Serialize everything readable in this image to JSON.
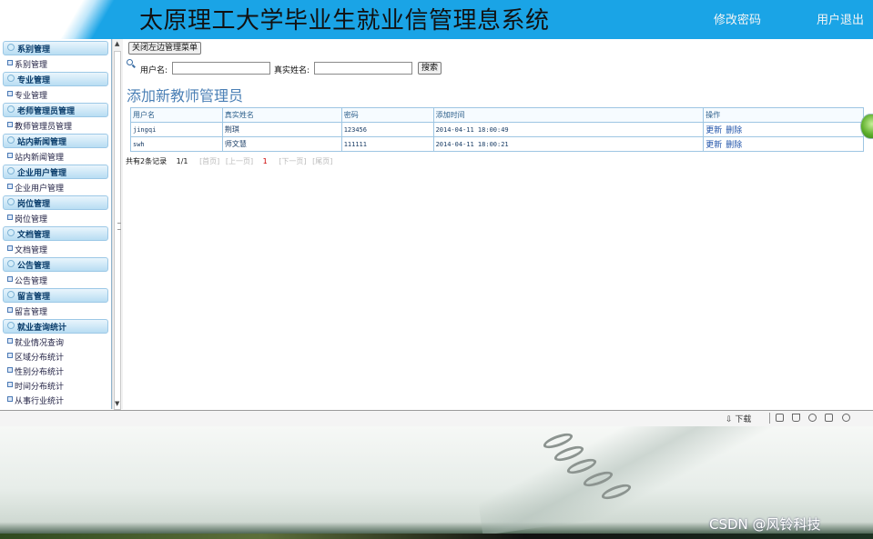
{
  "header": {
    "title": "太原理工大学毕业生就业信管理息系统",
    "change_password": "修改密码",
    "logout": "用户退出"
  },
  "sidebar": {
    "sections": [
      {
        "title": "系别管理",
        "items": [
          "系别管理"
        ]
      },
      {
        "title": "专业管理",
        "items": [
          "专业管理"
        ]
      },
      {
        "title": "老师管理员管理",
        "items": [
          "教师管理员管理"
        ]
      },
      {
        "title": "站内新闻管理",
        "items": [
          "站内新闻管理"
        ]
      },
      {
        "title": "企业用户管理",
        "items": [
          "企业用户管理"
        ]
      },
      {
        "title": "岗位管理",
        "items": [
          "岗位管理"
        ]
      },
      {
        "title": "文档管理",
        "items": [
          "文档管理"
        ]
      },
      {
        "title": "公告管理",
        "items": [
          "公告管理"
        ]
      },
      {
        "title": "留言管理",
        "items": [
          "留言管理"
        ]
      },
      {
        "title": "就业查询统计",
        "items": [
          "就业情况查询",
          "区域分布统计",
          "性别分布统计",
          "时间分布统计",
          "从事行业统计"
        ]
      }
    ]
  },
  "main": {
    "close_menu_button": "关闭左边管理菜单",
    "search": {
      "username_label": "用户名:",
      "username_value": "",
      "realname_label": "真实姓名:",
      "realname_value": "",
      "search_button": "搜索"
    },
    "page_title": "添加新教师管理员",
    "table": {
      "headers": [
        "用户名",
        "真实姓名",
        "密码",
        "添加时间",
        "操作"
      ],
      "rows": [
        {
          "username": "jingqi",
          "realname": "荆琪",
          "password": "123456",
          "added": "2014-04-11 18:00:49",
          "update": "更新",
          "delete": "删除"
        },
        {
          "username": "swh",
          "realname": "师文慧",
          "password": "111111",
          "added": "2014-04-11 18:00:21",
          "update": "更新",
          "delete": "删除"
        }
      ]
    },
    "pager": {
      "total": "共有2条记录",
      "pages": "1/1",
      "first": "[首页]",
      "prev": "[上一页]",
      "current": "1",
      "next": "[下一页]",
      "last": "[尾页]"
    }
  },
  "toolbar": {
    "download": "下载"
  },
  "watermark": "CSDN @风铃科技",
  "colors": {
    "header_bg": "#1aa4e6",
    "sidebar_section_bg": "#b8ddf3",
    "table_border": "#9ec6e3",
    "page_title": "#4a7fb5"
  }
}
